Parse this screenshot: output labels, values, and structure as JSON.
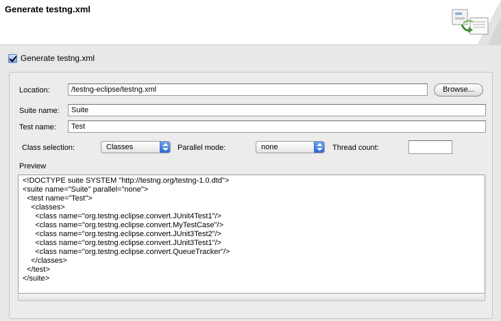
{
  "header": {
    "title": "Generate testng.xml"
  },
  "generate": {
    "checked": true,
    "label": "Generate testng.xml"
  },
  "form": {
    "location_label": "Location:",
    "location_value": "/testng-eclipse/testng.xml",
    "browse_label": "Browse...",
    "suite_label": "Suite name:",
    "suite_value": "Suite",
    "test_label": "Test name:",
    "test_value": "Test",
    "class_selection_label": "Class selection:",
    "class_selection_value": "Classes",
    "parallel_label": "Parallel mode:",
    "parallel_value": "none",
    "thread_label": "Thread count:",
    "thread_value": ""
  },
  "preview": {
    "label": "Preview",
    "lines": [
      "<!DOCTYPE suite SYSTEM \"http://testng.org/testng-1.0.dtd\">",
      "<suite name=\"Suite\" parallel=\"none\">",
      "  <test name=\"Test\">",
      "    <classes>",
      "      <class name=\"org.testng.eclipse.convert.JUnit4Test1\"/>",
      "      <class name=\"org.testng.eclipse.convert.MyTestCase\"/>",
      "      <class name=\"org.testng.eclipse.convert.JUnit3Test2\"/>",
      "      <class name=\"org.testng.eclipse.convert.JUnit3Test1\"/>",
      "      <class name=\"org.testng.eclipse.convert.QueueTracker\"/>",
      "    </classes>",
      "  </test>",
      "</suite>"
    ]
  },
  "icons": {
    "banner": "wizard-banner-icon",
    "dropdown": "chevron-updown-icon"
  }
}
